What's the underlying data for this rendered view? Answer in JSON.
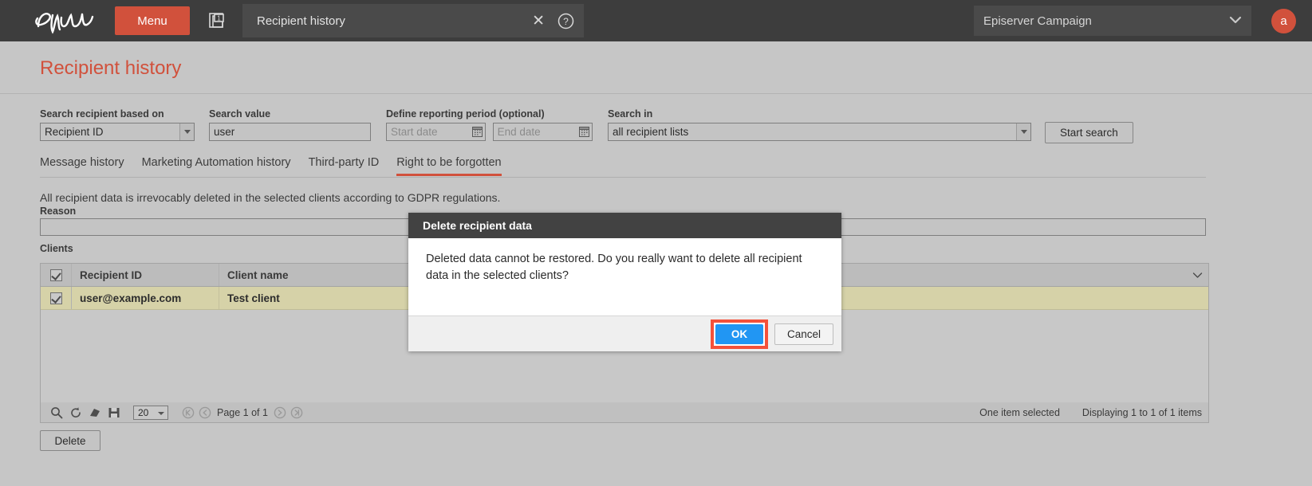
{
  "topbar": {
    "logo_alt": "episerver-logo",
    "menu_label": "Menu",
    "open_tabs_count": "1",
    "breadcrumb_title": "Recipient history",
    "close_label": "✕",
    "client_selector_value": "Episerver Campaign",
    "avatar_initial": "a"
  },
  "page": {
    "title": "Recipient history"
  },
  "search_form": {
    "based_on": {
      "label": "Search recipient based on",
      "value": "Recipient ID"
    },
    "search_value": {
      "label": "Search value",
      "value": "user"
    },
    "reporting_period": {
      "label": "Define reporting period (optional)",
      "start_placeholder": "Start date",
      "end_placeholder": "End date",
      "start_value": "",
      "end_value": ""
    },
    "search_in": {
      "label": "Search in",
      "value": "all recipient lists"
    },
    "start_search_label": "Start search"
  },
  "tabs": [
    {
      "label": "Message history",
      "active": false
    },
    {
      "label": "Marketing Automation history",
      "active": false
    },
    {
      "label": "Third-party ID",
      "active": false
    },
    {
      "label": "Right to be forgotten",
      "active": true
    }
  ],
  "content": {
    "gdpr_note": "All recipient data is irrevocably deleted in the selected clients according to GDPR regulations.",
    "reason_label": "Reason",
    "reason_value": "",
    "clients_label": "Clients"
  },
  "grid": {
    "columns": [
      "Recipient ID",
      "Client name"
    ],
    "rows": [
      {
        "checked": true,
        "recipient_id": "user@example.com",
        "client_name": "Test client"
      }
    ]
  },
  "grid_toolbar": {
    "icons": [
      "search-icon",
      "refresh-icon",
      "eraser-icon",
      "save-icon"
    ],
    "page_size": "20",
    "page_text": "Page 1 of 1",
    "selection_status": "One item selected",
    "display_status": "Displaying 1 to 1 of 1 items"
  },
  "actions": {
    "delete_label": "Delete"
  },
  "modal": {
    "title": "Delete recipient data",
    "message": "Deleted data cannot be restored. Do you really want to delete all recipient data in the selected clients?",
    "ok_label": "OK",
    "cancel_label": "Cancel"
  },
  "colors": {
    "brand_red": "#d1513c",
    "highlight_red": "#f4513a",
    "primary_blue": "#2196f3",
    "row_selected": "#d6d2a8",
    "page_bg": "#c6c6c6",
    "topbar_bg": "#3d3d3d"
  }
}
